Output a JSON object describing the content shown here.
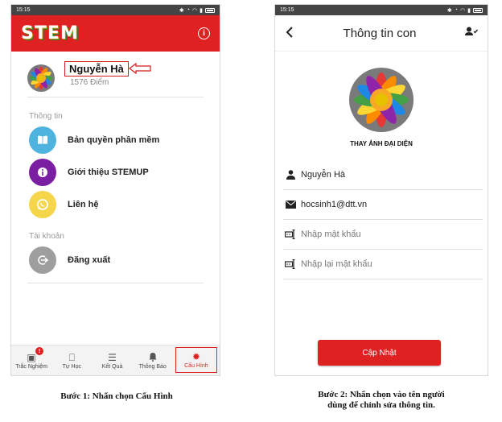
{
  "status_time": "15:15",
  "screen1": {
    "logo": "STEM",
    "profile": {
      "name": "Nguyễn Hà",
      "score": "1576 Điểm"
    },
    "sections": [
      {
        "label": "Thông tin",
        "items": [
          {
            "label": "Bản quyền phần mềm",
            "icon": "book-icon",
            "color": "#4fb3e0"
          },
          {
            "label": "Giới thiệu STEMUP",
            "icon": "info-icon",
            "color": "#7b1fa2"
          },
          {
            "label": "Liên hệ",
            "icon": "whatsapp-icon",
            "color": "#f5d54a"
          }
        ]
      },
      {
        "label": "Tài khoản",
        "items": [
          {
            "label": "Đăng xuất",
            "icon": "logout-icon",
            "color": "#9e9e9e"
          }
        ]
      }
    ],
    "tabs": [
      {
        "label": "Trắc Nghiệm",
        "icon": "quiz-icon",
        "badge": "!"
      },
      {
        "label": "Tự Học",
        "icon": "book-open-icon"
      },
      {
        "label": "Kết Quả",
        "icon": "result-list-icon"
      },
      {
        "label": "Thông Báo",
        "icon": "bell-icon"
      },
      {
        "label": "Cấu Hình",
        "icon": "gear-icon",
        "active": true
      }
    ]
  },
  "screen2": {
    "title": "Thông tin con",
    "change_photo": "THAY ẢNH ĐẠI DIỆN",
    "fields": [
      {
        "value": "Nguyễn Hà",
        "icon": "person-icon"
      },
      {
        "value": "hocsinh1@dtt.vn",
        "icon": "email-icon"
      },
      {
        "placeholder": "Nhập mật khẩu",
        "icon": "password-icon"
      },
      {
        "placeholder": "Nhập lại mật khẩu",
        "icon": "password-icon"
      }
    ],
    "update_button": "Cập Nhật"
  },
  "captions": {
    "step1": "Bước 1: Nhấn chọn Cấu Hình",
    "step2_line1": "Bước 2: Nhấn chọn vào tên người",
    "step2_line2": "dùng để chỉnh sửa thông tin."
  },
  "colors": {
    "brand_red": "#e02121",
    "status_bar": "#444444"
  }
}
